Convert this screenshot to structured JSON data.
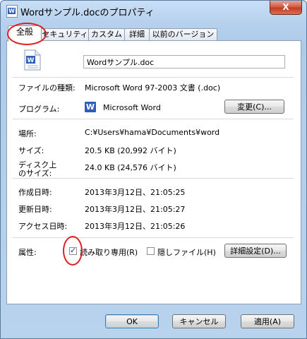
{
  "window": {
    "title": "Wordサンプル.docのプロパティ",
    "close_glyph": "X"
  },
  "tabs": [
    {
      "label": "全般",
      "active": true
    },
    {
      "label": "セキュリティ",
      "active": false
    },
    {
      "label": "カスタム",
      "active": false
    },
    {
      "label": "詳細",
      "active": false
    },
    {
      "label": "以前のバージョン",
      "active": false
    }
  ],
  "general": {
    "filename": "Wordサンプル.doc",
    "file_type_label": "ファイルの種類:",
    "file_type_value": "Microsoft Word 97-2003 文書 (.doc)",
    "program_label": "プログラム:",
    "program_value": "Microsoft Word",
    "change_button": "変更(C)...",
    "location_label": "場所:",
    "location_value": "C:¥Users¥hama¥Documents¥word",
    "size_label": "サイズ:",
    "size_value": "20.5 KB (20,992 バイト)",
    "disk_size_label_1": "ディスク上",
    "disk_size_label_2": "のサイズ:",
    "disk_size_value": "24.0 KB (24,576 バイト)",
    "created_label": "作成日時:",
    "created_value": "2013年3月12日、21:05:25",
    "modified_label": "更新日時:",
    "modified_value": "2013年3月12日、21:05:27",
    "accessed_label": "アクセス日時:",
    "accessed_value": "2013年3月12日、21:05:26",
    "attributes_label": "属性:",
    "readonly_label": "読み取り専用(R)",
    "readonly_checked": true,
    "hidden_label": "隠しファイル(H)",
    "hidden_checked": false,
    "advanced_button": "詳細設定(D)..."
  },
  "footer": {
    "ok": "OK",
    "cancel": "キャンセル",
    "apply": "適用(A)"
  },
  "icons": {
    "check_glyph": "✓",
    "word_letter": "W"
  },
  "colors": {
    "highlight_circle": "#e02020",
    "word_blue": "#2f5eb8"
  }
}
